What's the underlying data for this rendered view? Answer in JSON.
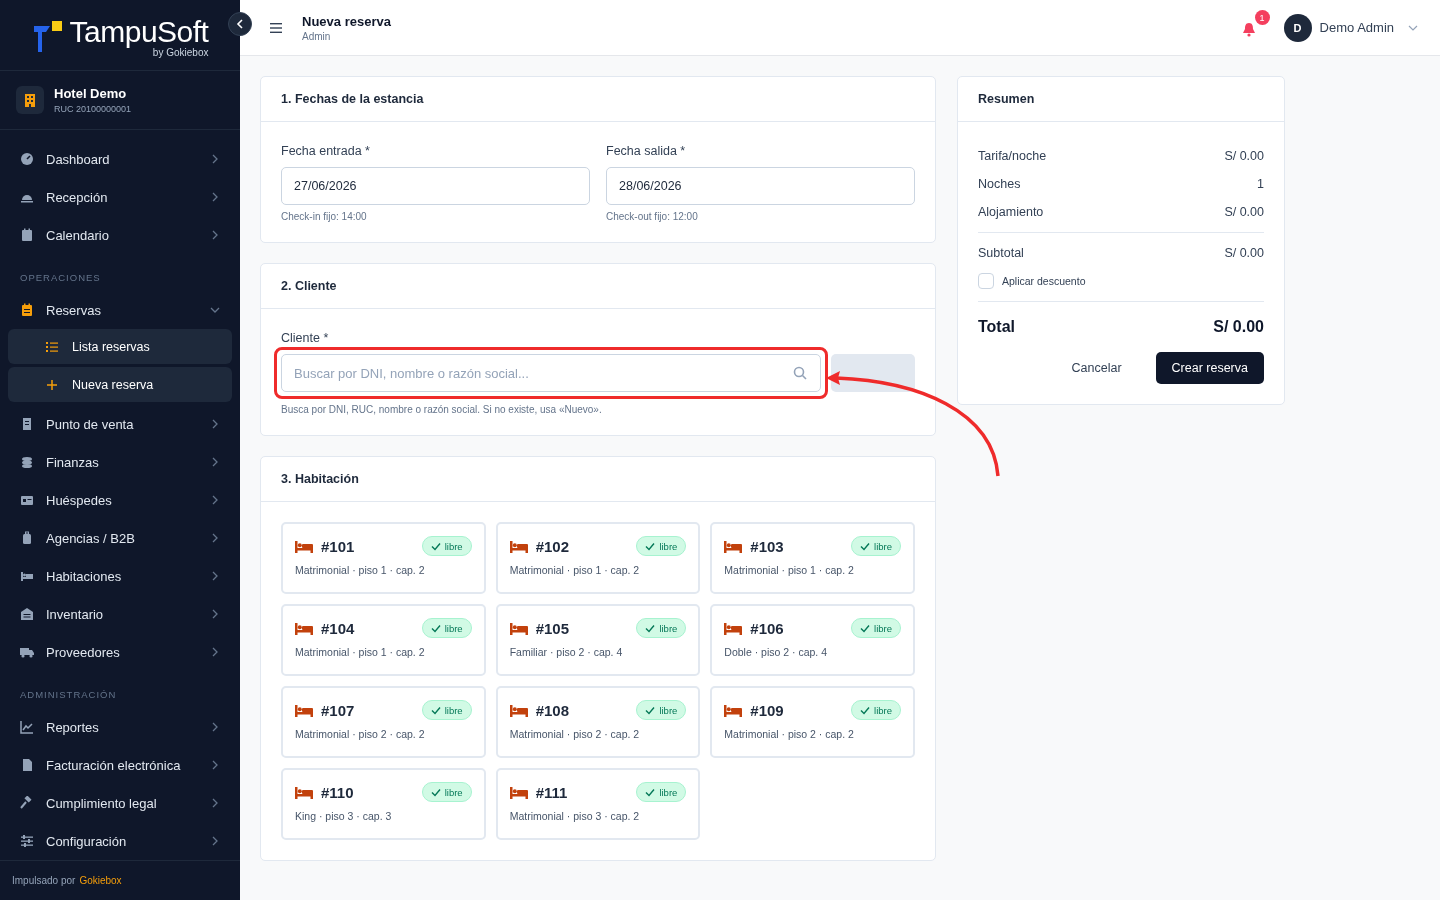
{
  "brand": {
    "name": "TampuSoft",
    "tagline": "by Gokiebox"
  },
  "hotel": {
    "name": "Hotel Demo",
    "ruc": "RUC 20100000001"
  },
  "sidebar": {
    "sections": [
      {
        "items": [
          {
            "label": "Dashboard",
            "expanded": false
          },
          {
            "label": "Recepción",
            "expanded": false
          },
          {
            "label": "Calendario",
            "expanded": false
          }
        ]
      },
      {
        "title": "OPERACIONES",
        "items": [
          {
            "label": "Reservas",
            "expanded": true,
            "children": [
              {
                "label": "Lista reservas"
              },
              {
                "label": "Nueva reserva"
              }
            ]
          },
          {
            "label": "Punto de venta",
            "expanded": false
          },
          {
            "label": "Finanzas",
            "expanded": false
          },
          {
            "label": "Huéspedes",
            "expanded": false
          },
          {
            "label": "Agencias / B2B",
            "expanded": false
          },
          {
            "label": "Habitaciones",
            "expanded": false
          },
          {
            "label": "Inventario",
            "expanded": false
          },
          {
            "label": "Proveedores",
            "expanded": false
          }
        ]
      },
      {
        "title": "ADMINISTRACIÓN",
        "items": [
          {
            "label": "Reportes",
            "expanded": false
          },
          {
            "label": "Facturación electrónica",
            "expanded": false
          },
          {
            "label": "Cumplimiento legal",
            "expanded": false
          },
          {
            "label": "Configuración",
            "expanded": false
          }
        ]
      }
    ],
    "footer": {
      "text": "Impulsado por",
      "link": "Gokiebox"
    }
  },
  "header": {
    "title": "Nueva reserva",
    "subtitle": "Admin",
    "notifications": "1",
    "user": {
      "initial": "D",
      "name": "Demo Admin"
    }
  },
  "stay": {
    "title": "1. Fechas de la estancia",
    "fields": [
      {
        "label": "Fecha entrada *",
        "value": "27/06/2026",
        "hint": "Check-in fijo: 14:00"
      },
      {
        "label": "Fecha salida *",
        "value": "28/06/2026",
        "hint": "Check-out fijo: 12:00"
      }
    ]
  },
  "client": {
    "title": "2. Cliente",
    "label": "Cliente *",
    "placeholder": "Buscar por DNI, nombre o razón social...",
    "hint": "Busca por DNI, RUC, nombre o razón social. Si no existe, usa «Nuevo»."
  },
  "rooms": {
    "title": "3. Habitación",
    "items": [
      {
        "number": "#101",
        "info": "Matrimonial · piso 1 · cap. 2",
        "status": "libre"
      },
      {
        "number": "#102",
        "info": "Matrimonial · piso 1 · cap. 2",
        "status": "libre"
      },
      {
        "number": "#103",
        "info": "Matrimonial · piso 1 · cap. 2",
        "status": "libre"
      },
      {
        "number": "#104",
        "info": "Matrimonial · piso 1 · cap. 2",
        "status": "libre"
      },
      {
        "number": "#105",
        "info": "Familiar · piso 2 · cap. 4",
        "status": "libre"
      },
      {
        "number": "#106",
        "info": "Doble · piso 2 · cap. 4",
        "status": "libre"
      },
      {
        "number": "#107",
        "info": "Matrimonial · piso 2 · cap. 2",
        "status": "libre"
      },
      {
        "number": "#108",
        "info": "Matrimonial · piso 2 · cap. 2",
        "status": "libre"
      },
      {
        "number": "#109",
        "info": "Matrimonial · piso 2 · cap. 2",
        "status": "libre"
      },
      {
        "number": "#110",
        "info": "King · piso 3 · cap. 3",
        "status": "libre"
      },
      {
        "number": "#111",
        "info": "Matrimonial · piso 3 · cap. 2",
        "status": "libre"
      }
    ]
  },
  "summary": {
    "title": "Resumen",
    "rows": [
      {
        "label": "Tarifa/noche",
        "value": "S/ 0.00"
      },
      {
        "label": "Noches",
        "value": "1"
      },
      {
        "label": "Alojamiento",
        "value": "S/ 0.00"
      }
    ],
    "subtotal": {
      "label": "Subtotal",
      "value": "S/ 0.00"
    },
    "discount": {
      "label": "Aplicar descuento",
      "checked": false
    },
    "total": {
      "label": "Total",
      "value": "S/ 0.00"
    },
    "buttons": {
      "cancel": "Cancelar",
      "submit": "Crear reserva"
    }
  }
}
